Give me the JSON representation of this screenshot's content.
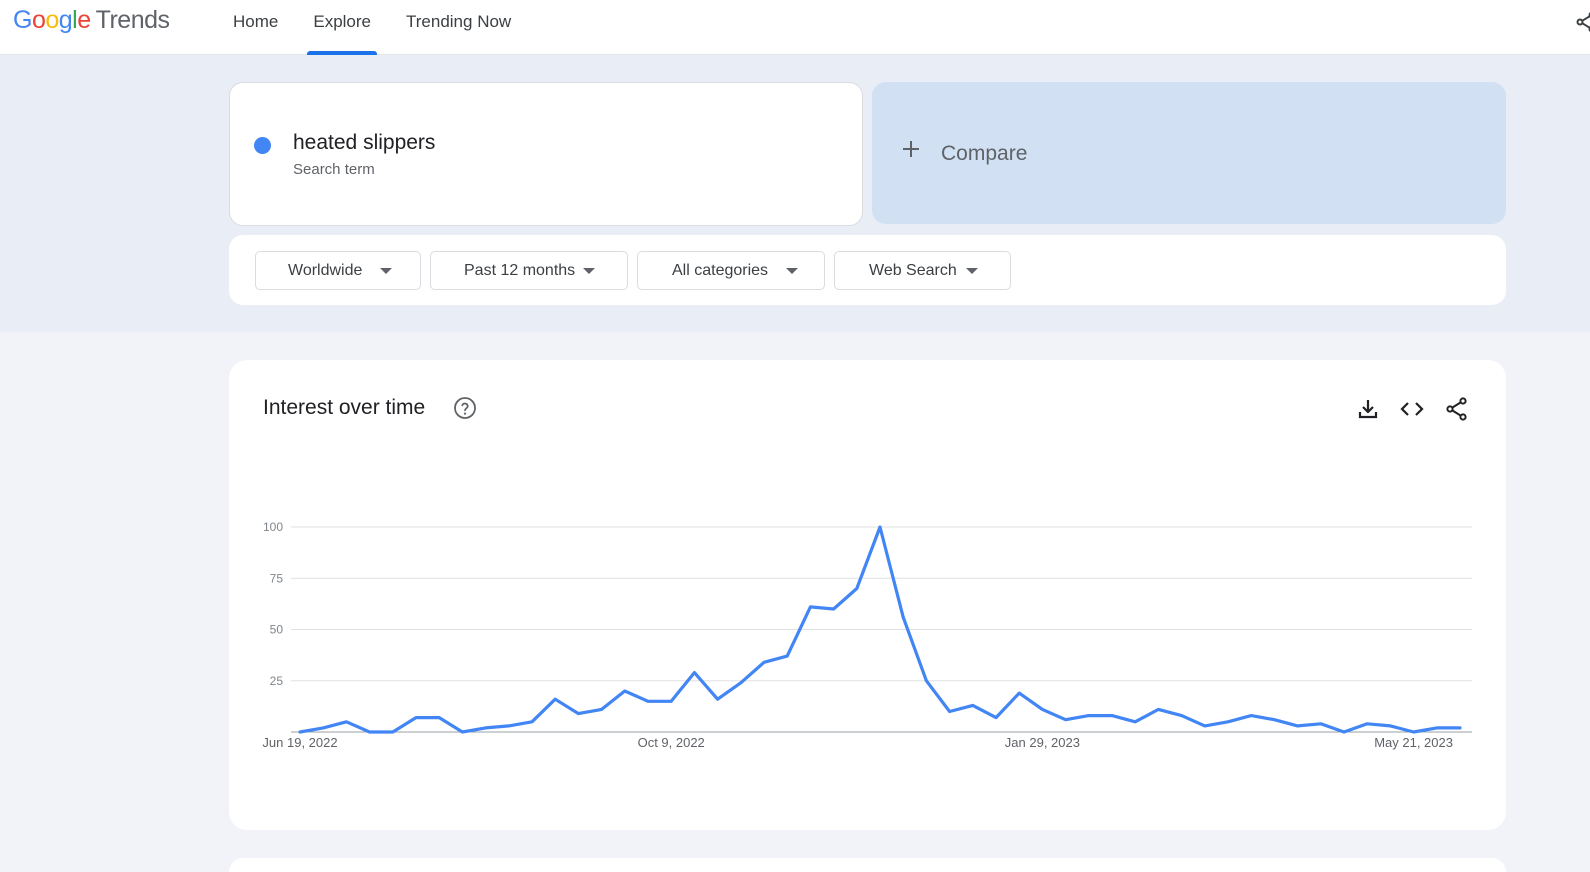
{
  "header": {
    "logo": {
      "google_letters": [
        "G",
        "o",
        "o",
        "g",
        "l",
        "e"
      ],
      "trends": "Trends"
    },
    "nav": [
      {
        "label": "Home",
        "active": false
      },
      {
        "label": "Explore",
        "active": true
      },
      {
        "label": "Trending Now",
        "active": false
      }
    ]
  },
  "search": {
    "term": "heated slippers",
    "term_type": "Search term",
    "term_color": "#4285f4",
    "compare_label": "Compare"
  },
  "filters": [
    {
      "label": "Worldwide"
    },
    {
      "label": "Past 12 months"
    },
    {
      "label": "All categories"
    },
    {
      "label": "Web Search"
    }
  ],
  "interest": {
    "title": "Interest over time",
    "icons": [
      "help-icon",
      "download-icon",
      "embed-code-icon",
      "share-icon"
    ]
  },
  "chart_data": {
    "type": "line",
    "title": "Interest over time",
    "xlabel": "",
    "ylabel": "",
    "ylim": [
      0,
      100
    ],
    "yticks": [
      "25",
      "50",
      "75",
      "100"
    ],
    "xticks": [
      "Jun 19, 2022",
      "Oct 9, 2022",
      "Jan 29, 2023",
      "May 21, 2023"
    ],
    "xtick_index": [
      0,
      16,
      32,
      48
    ],
    "grid": true,
    "series": [
      {
        "color": "#4285f4",
        "values": [
          0,
          2,
          5,
          0,
          0,
          7,
          7,
          0,
          2,
          3,
          5,
          16,
          9,
          11,
          20,
          15,
          15,
          29,
          16,
          24,
          34,
          37,
          61,
          60,
          70,
          100,
          56,
          25,
          10,
          13,
          7,
          19,
          11,
          6,
          8,
          8,
          5,
          11,
          8,
          3,
          5,
          8,
          6,
          3,
          4,
          0,
          4,
          3,
          0,
          2,
          2
        ]
      }
    ]
  }
}
